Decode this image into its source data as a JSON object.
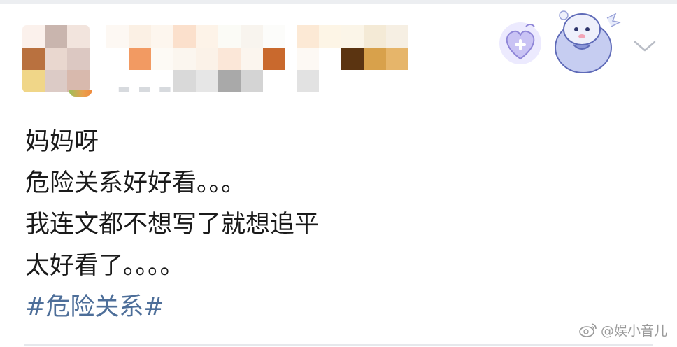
{
  "post": {
    "lines": [
      "妈妈呀",
      "危险关系好好看。。。",
      "我连文都不想写了就想追平",
      "太好看了。。。。"
    ],
    "hashtag": "#危险关系#"
  },
  "author": {
    "avatar": "pixelated-avatar",
    "name_mosaic": "pixelated-username"
  },
  "header": {
    "icons": [
      "heart-badge-icon",
      "mascot-badge-icon",
      "chevron-down-icon"
    ]
  },
  "watermark": {
    "text": "@娱小音儿",
    "icon": "weibo-logo-icon"
  },
  "colors": {
    "text": "#1a1a1a",
    "hashtag": "#4d6e99",
    "watermark": "#9a9a9a",
    "background": "#ffffff"
  }
}
